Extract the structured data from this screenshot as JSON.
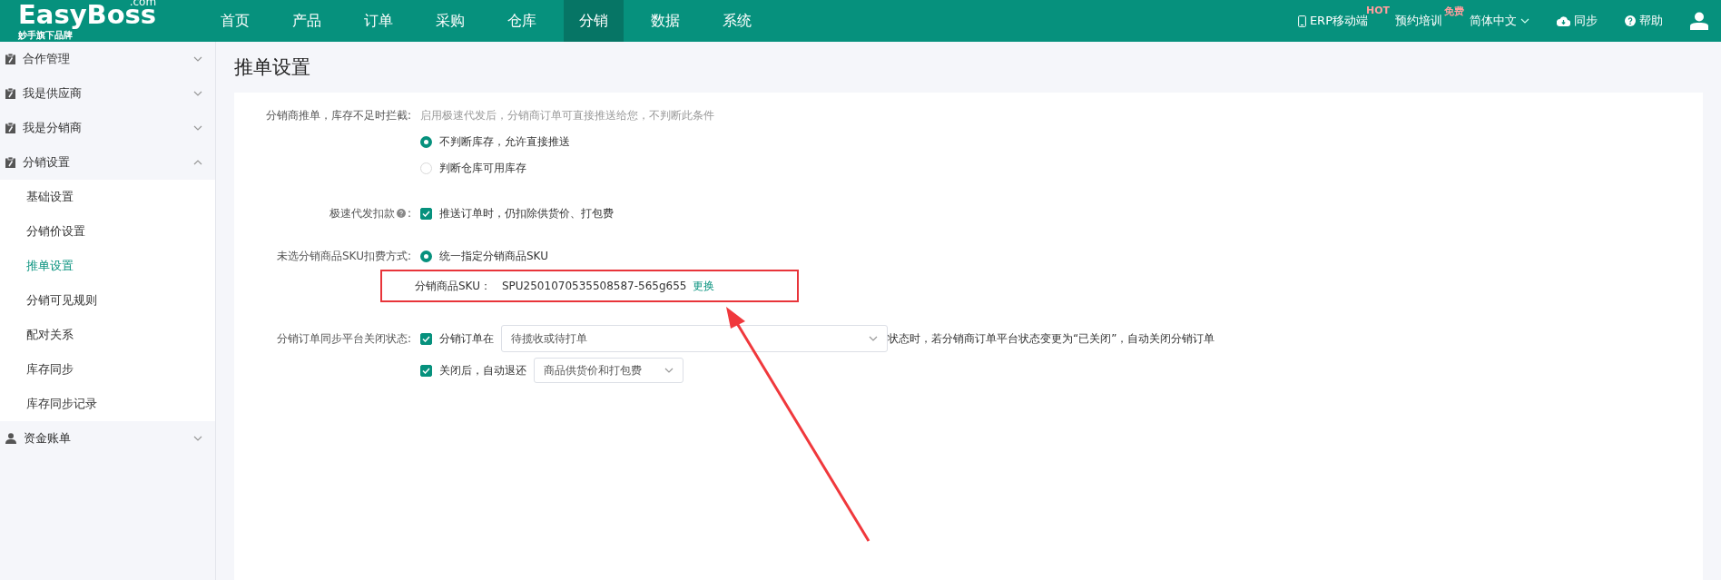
{
  "logo": {
    "name": "EasyBoss",
    "suffix": ".com",
    "tagline": "妙手旗下品牌"
  },
  "nav": [
    {
      "label": "首页",
      "selected": false
    },
    {
      "label": "产品",
      "selected": false
    },
    {
      "label": "订单",
      "selected": false
    },
    {
      "label": "采购",
      "selected": false
    },
    {
      "label": "仓库",
      "selected": false
    },
    {
      "label": "分销",
      "selected": true
    },
    {
      "label": "数据",
      "selected": false
    },
    {
      "label": "系统",
      "selected": false
    }
  ],
  "header_links": [
    {
      "kind": "mobile",
      "label": "ERP移动端",
      "badge": "HOT"
    },
    {
      "kind": "plain",
      "label": "预约培训",
      "badge": "免费"
    },
    {
      "kind": "dropdown",
      "label": "简体中文"
    },
    {
      "kind": "sync",
      "label": "同步"
    },
    {
      "kind": "help",
      "label": "帮助"
    }
  ],
  "sidebar": [
    {
      "label": "合作管理",
      "expanded": false
    },
    {
      "label": "我是供应商",
      "expanded": false
    },
    {
      "label": "我是分销商",
      "expanded": false
    },
    {
      "label": "分销设置",
      "expanded": true,
      "children": [
        {
          "label": "基础设置",
          "selected": false
        },
        {
          "label": "分销价设置",
          "selected": false
        },
        {
          "label": "推单设置",
          "selected": true
        },
        {
          "label": "分销可见规则",
          "selected": false
        },
        {
          "label": "配对关系",
          "selected": false
        },
        {
          "label": "库存同步",
          "selected": false
        },
        {
          "label": "库存同步记录",
          "selected": false
        }
      ]
    },
    {
      "label": "资金账单",
      "expanded": false
    }
  ],
  "page_title": "推单设置",
  "form": {
    "stock_intercept": {
      "label": "分销商推单，库存不足时拦截:",
      "hint": "启用极速代发后，分销商订单可直接推送给您，不判断此条件",
      "options": [
        {
          "label": "不判断库存，允许直接推送",
          "selected": true
        },
        {
          "label": "判断仓库可用库存",
          "selected": false
        }
      ]
    },
    "fast_deduct": {
      "label": "极速代发扣款",
      "label_colon": ":",
      "option": {
        "label": "推送订单时，仍扣除供货价、打包费",
        "checked": true
      }
    },
    "sku_mode": {
      "label": "未选分销商品SKU扣费方式:",
      "options": [
        {
          "label": "统一指定分销商品SKU",
          "selected": true
        }
      ],
      "sku_label": "分销商品SKU：",
      "sku_value": "SPU2501070535508587-565g655",
      "change_link": "更换"
    },
    "close_sync": {
      "label": "分销订单同步平台关闭状态:",
      "order": {
        "label": "分销订单在",
        "checked": true,
        "select_value": "待揽收或待打单",
        "suffix": "状态时，若分销商订单平台状态变更为“已关闭”，自动关闭分销订单"
      },
      "refund": {
        "label": "关闭后，自动退还",
        "checked": true,
        "select_value": "商品供货价和打包费"
      }
    }
  }
}
